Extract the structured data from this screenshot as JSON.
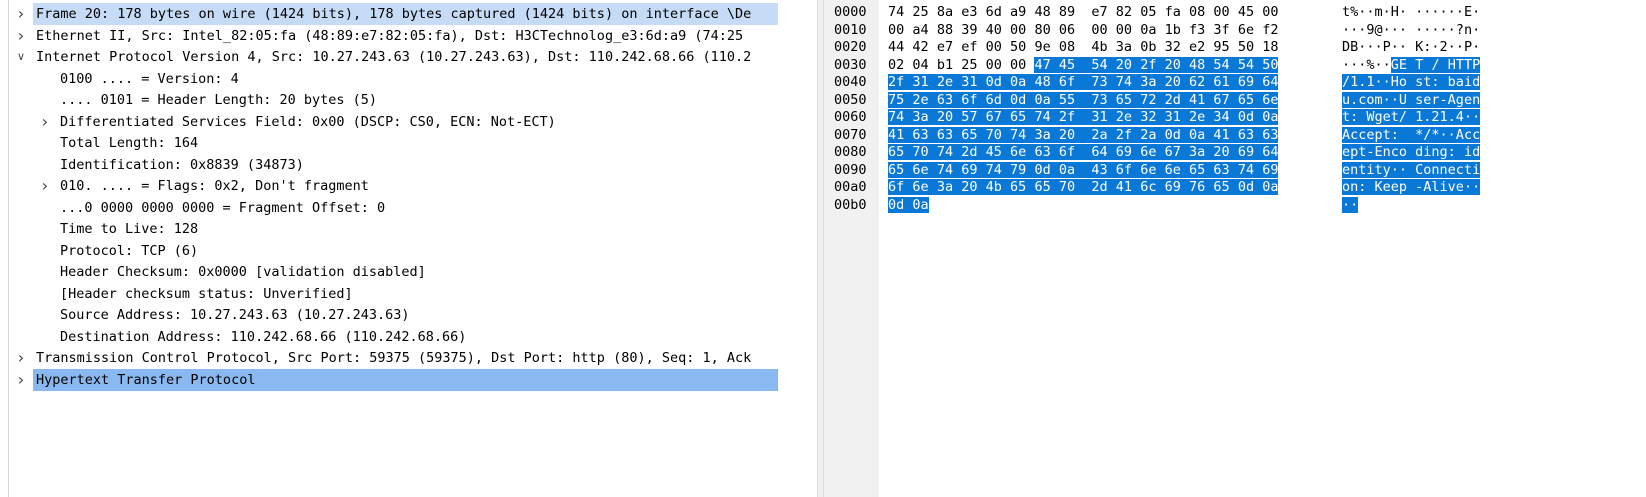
{
  "tree": [
    {
      "arrow": ">",
      "indent": 0,
      "text": "Frame 20: 178 bytes on wire (1424 bits), 178 bytes captured (1424 bits) on interface \\De",
      "sel": "dim"
    },
    {
      "arrow": ">",
      "indent": 0,
      "text": "Ethernet II, Src: Intel_82:05:fa (48:89:e7:82:05:fa), Dst: H3CTechnolog_e3:6d:a9 (74:25",
      "sel": ""
    },
    {
      "arrow": "v",
      "indent": 0,
      "text": "Internet Protocol Version 4, Src: 10.27.243.63 (10.27.243.63), Dst: 110.242.68.66 (110.2",
      "sel": ""
    },
    {
      "arrow": "",
      "indent": 1,
      "text": "0100 .... = Version: 4",
      "sel": ""
    },
    {
      "arrow": "",
      "indent": 1,
      "text": ".... 0101 = Header Length: 20 bytes (5)",
      "sel": ""
    },
    {
      "arrow": ">",
      "indent": 1,
      "text": "Differentiated Services Field: 0x00 (DSCP: CS0, ECN: Not-ECT)",
      "sel": ""
    },
    {
      "arrow": "",
      "indent": 1,
      "text": "Total Length: 164",
      "sel": ""
    },
    {
      "arrow": "",
      "indent": 1,
      "text": "Identification: 0x8839 (34873)",
      "sel": ""
    },
    {
      "arrow": ">",
      "indent": 1,
      "text": "010. .... = Flags: 0x2, Don't fragment",
      "sel": ""
    },
    {
      "arrow": "",
      "indent": 1,
      "text": "...0 0000 0000 0000 = Fragment Offset: 0",
      "sel": ""
    },
    {
      "arrow": "",
      "indent": 1,
      "text": "Time to Live: 128",
      "sel": ""
    },
    {
      "arrow": "",
      "indent": 1,
      "text": "Protocol: TCP (6)",
      "sel": ""
    },
    {
      "arrow": "",
      "indent": 1,
      "text": "Header Checksum: 0x0000 [validation disabled]",
      "sel": ""
    },
    {
      "arrow": "",
      "indent": 1,
      "text": "[Header checksum status: Unverified]",
      "sel": ""
    },
    {
      "arrow": "",
      "indent": 1,
      "text": "Source Address: 10.27.243.63 (10.27.243.63)",
      "sel": ""
    },
    {
      "arrow": "",
      "indent": 1,
      "text": "Destination Address: 110.242.68.66 (110.242.68.66)",
      "sel": ""
    },
    {
      "arrow": ">",
      "indent": 0,
      "text": "Transmission Control Protocol, Src Port: 59375 (59375), Dst Port: http (80), Seq: 1, Ack",
      "sel": ""
    },
    {
      "arrow": ">",
      "indent": 0,
      "text": "Hypertext Transfer Protocol",
      "sel": "strong"
    }
  ],
  "hex": [
    {
      "offset": "0000",
      "bytes": [
        "74",
        "25",
        "8a",
        "e3",
        "6d",
        "a9",
        "48",
        "89",
        "e7",
        "82",
        "05",
        "fa",
        "08",
        "00",
        "45",
        "00"
      ],
      "ascii": [
        "t%··m·H·",
        "······E·"
      ],
      "hl_from": -1,
      "hl_to": -1
    },
    {
      "offset": "0010",
      "bytes": [
        "00",
        "a4",
        "88",
        "39",
        "40",
        "00",
        "80",
        "06",
        "00",
        "00",
        "0a",
        "1b",
        "f3",
        "3f",
        "6e",
        "f2"
      ],
      "ascii": [
        "···9@···",
        "·····?n·"
      ],
      "hl_from": -1,
      "hl_to": -1
    },
    {
      "offset": "0020",
      "bytes": [
        "44",
        "42",
        "e7",
        "ef",
        "00",
        "50",
        "9e",
        "08",
        "4b",
        "3a",
        "0b",
        "32",
        "e2",
        "95",
        "50",
        "18"
      ],
      "ascii": [
        "DB···P··",
        "K:·2··P·"
      ],
      "hl_from": -1,
      "hl_to": -1
    },
    {
      "offset": "0030",
      "bytes": [
        "02",
        "04",
        "b1",
        "25",
        "00",
        "00",
        "47",
        "45",
        "54",
        "20",
        "2f",
        "20",
        "48",
        "54",
        "54",
        "50"
      ],
      "ascii": [
        "···%··GE",
        "T / HTTP"
      ],
      "hl_from": -1,
      "hl_to": -1
    },
    {
      "offset": "0040",
      "bytes": [
        "2f",
        "31",
        "2e",
        "31",
        "0d",
        "0a",
        "48",
        "6f",
        "73",
        "74",
        "3a",
        "20",
        "62",
        "61",
        "69",
        "64"
      ],
      "ascii": [
        "/1.1··Ho",
        "st: baid"
      ],
      "hl_from": -1,
      "hl_to": -1
    },
    {
      "offset": "0050",
      "bytes": [
        "75",
        "2e",
        "63",
        "6f",
        "6d",
        "0d",
        "0a",
        "55",
        "73",
        "65",
        "72",
        "2d",
        "41",
        "67",
        "65",
        "6e"
      ],
      "ascii": [
        "u.com··U",
        "ser-Agen"
      ],
      "hl_from": -1,
      "hl_to": -1
    },
    {
      "offset": "0060",
      "bytes": [
        "74",
        "3a",
        "20",
        "57",
        "67",
        "65",
        "74",
        "2f",
        "31",
        "2e",
        "32",
        "31",
        "2e",
        "34",
        "0d",
        "0a"
      ],
      "ascii": [
        "t: Wget/",
        "1.21.4··"
      ],
      "hl_from": -1,
      "hl_to": -1
    },
    {
      "offset": "0070",
      "bytes": [
        "41",
        "63",
        "63",
        "65",
        "70",
        "74",
        "3a",
        "20",
        "2a",
        "2f",
        "2a",
        "0d",
        "0a",
        "41",
        "63",
        "63"
      ],
      "ascii": [
        "Accept: ",
        "*/*··Acc"
      ],
      "hl_from": -1,
      "hl_to": -1
    },
    {
      "offset": "0080",
      "bytes": [
        "65",
        "70",
        "74",
        "2d",
        "45",
        "6e",
        "63",
        "6f",
        "64",
        "69",
        "6e",
        "67",
        "3a",
        "20",
        "69",
        "64"
      ],
      "ascii": [
        "ept-Enco",
        "ding: id"
      ],
      "hl_from": -1,
      "hl_to": -1
    },
    {
      "offset": "0090",
      "bytes": [
        "65",
        "6e",
        "74",
        "69",
        "74",
        "79",
        "0d",
        "0a",
        "43",
        "6f",
        "6e",
        "6e",
        "65",
        "63",
        "74",
        "69"
      ],
      "ascii": [
        "entity··",
        "Connecti"
      ],
      "hl_from": -1,
      "hl_to": -1
    },
    {
      "offset": "00a0",
      "bytes": [
        "6f",
        "6e",
        "3a",
        "20",
        "4b",
        "65",
        "65",
        "70",
        "2d",
        "41",
        "6c",
        "69",
        "76",
        "65",
        "0d",
        "0a"
      ],
      "ascii": [
        "on: Keep",
        "-Alive··"
      ],
      "hl_from": -1,
      "hl_to": -1
    },
    {
      "offset": "00b0",
      "bytes": [
        "0d",
        "0a"
      ],
      "ascii": [
        "··",
        ""
      ],
      "hl_from": -1,
      "hl_to": -1
    }
  ],
  "highlight_start_index": 54,
  "colors": {
    "hl": "#0a78d7",
    "sel_dim": "#c6dcf6",
    "sel_strong": "#8ab8f0"
  }
}
